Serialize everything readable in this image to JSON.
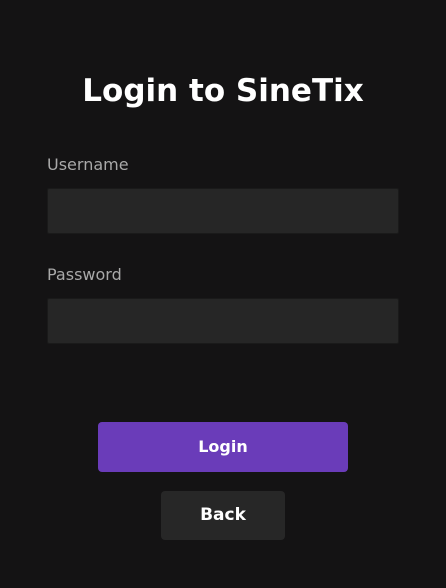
{
  "form": {
    "title": "Login to SineTix",
    "username": {
      "label": "Username",
      "value": "",
      "placeholder": ""
    },
    "password": {
      "label": "Password",
      "value": "",
      "placeholder": ""
    },
    "login_label": "Login",
    "back_label": "Back"
  },
  "colors": {
    "background": "#141314",
    "field_background": "#262626",
    "primary_button": "#6a3cb9",
    "secondary_button": "#272727",
    "label_text": "#a9a9a9",
    "title_text": "#ffffff"
  }
}
